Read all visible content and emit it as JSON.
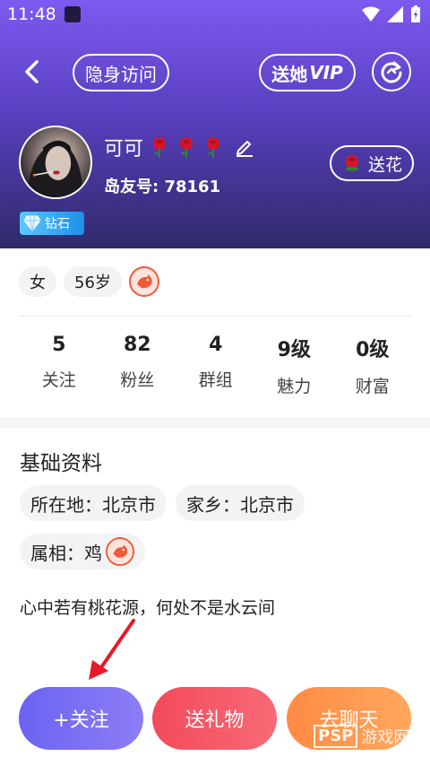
{
  "status_bar": {
    "time": "11:48"
  },
  "topbar": {
    "incognito_label": "隐身访问",
    "vip_prefix": "送她",
    "vip_suffix": "VIP"
  },
  "profile": {
    "name": "可可",
    "id_label": "岛友号:",
    "id_value": "78161",
    "badge": "钻石",
    "flower_label": "送花",
    "rose_color": "#d4142a"
  },
  "tags": [
    "女",
    "56岁"
  ],
  "stats": [
    {
      "value": "5",
      "label": "关注"
    },
    {
      "value": "82",
      "label": "粉丝"
    },
    {
      "value": "4",
      "label": "群组"
    },
    {
      "value": "9级",
      "label": "魅力"
    },
    {
      "value": "0级",
      "label": "财富"
    }
  ],
  "basic_info": {
    "title": "基础资料",
    "location": "所在地：北京市",
    "hometown": "家乡：北京市",
    "zodiac": "属相：鸡",
    "signature": "心中若有桃花源，何处不是水云间"
  },
  "actions": {
    "follow": "+关注",
    "gift": "送礼物",
    "chat": "去聊天"
  },
  "watermark": {
    "box": "PSP",
    "text": "游戏网"
  },
  "colors": {
    "header_top": "#7d5af0",
    "header_bottom": "#2f2a6a",
    "follow": "#7a70f4",
    "gift": "#f4525f",
    "chat": "#ff9450"
  }
}
